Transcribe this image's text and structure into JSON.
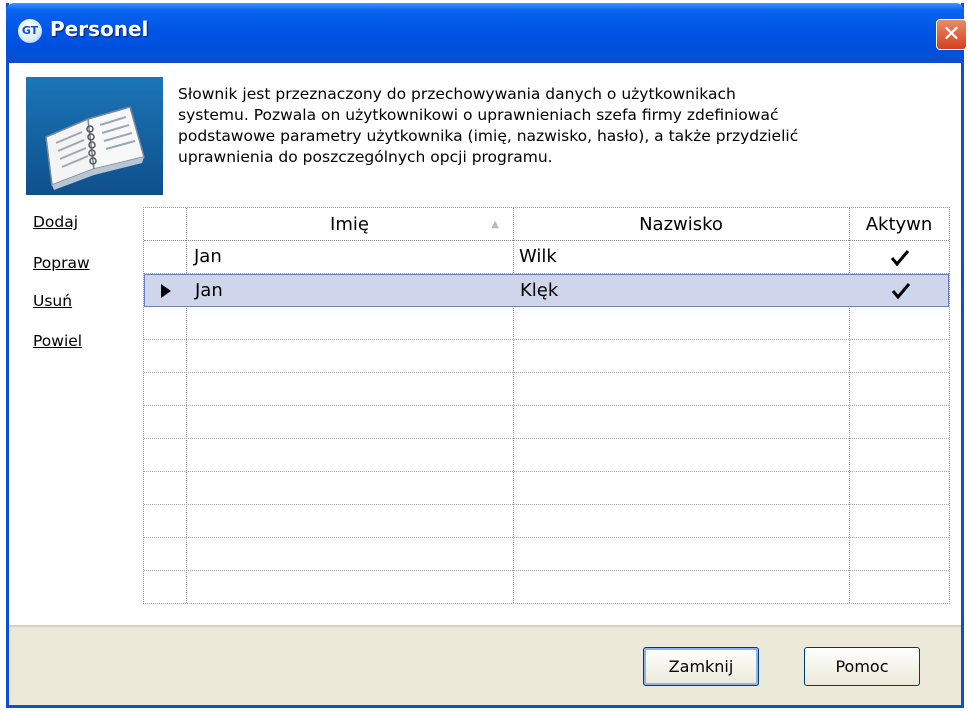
{
  "window": {
    "title": "Personel",
    "app_badge": "GT",
    "close_glyph": "✕"
  },
  "description": {
    "lines": [
      "Słownik jest przeznaczony do przechowywania danych o użytkownikach",
      "systemu. Pozwala on użytkownikowi o uprawnieniach szefa firmy zdefiniować",
      "podstawowe parametry użytkownika (imię, nazwisko, hasło), a także przydzielić",
      "uprawnienia do poszczególnych opcji programu."
    ]
  },
  "actions": {
    "add": "Dodaj",
    "edit": "Popraw",
    "delete": "Usuń",
    "duplicate": "Powiel"
  },
  "grid": {
    "columns": {
      "first_name": "Imię",
      "last_name": "Nazwisko",
      "active": "Aktywn"
    },
    "sort_indicator": "▲",
    "rows": [
      {
        "first_name": "Jan",
        "last_name": "Wilk",
        "active": true,
        "selected": false
      },
      {
        "first_name": "Jan",
        "last_name": "Klęk",
        "active": true,
        "selected": true
      }
    ]
  },
  "buttons": {
    "close": "Zamknij",
    "help": "Pomoc"
  },
  "colors": {
    "title_bar": "#0a4fd4",
    "selection": "#cfd6ec",
    "close_button": "#d4401d"
  },
  "icons": {
    "header_image": "open-book-icon",
    "row_pointer": "row-pointer-icon",
    "active_check": "checkmark-icon"
  }
}
